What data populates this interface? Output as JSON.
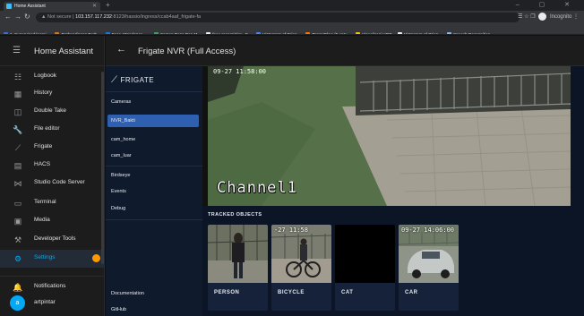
{
  "browser": {
    "tab_title": "Home Assistant",
    "new_tab_glyph": "+",
    "window_controls": "– ▢ ✕",
    "security_label": "Not secure",
    "url_host": "103.157.117.232",
    "url_path": ":8123/hassio/ingress/ccab4aaf_frigate-fa",
    "right_controls": "☰  ☆  ❐",
    "incognito_label": "Incognito",
    "bookmarks": [
      {
        "label": "1. Supervised learni...",
        "color": "#3b6edc"
      },
      {
        "label": "Perbandingan Berb...",
        "color": "#e8710a"
      },
      {
        "label": "Face Attendance -...",
        "color": "#1a73e8"
      },
      {
        "label": "Saman Desa Dan M...",
        "color": "#34a853"
      },
      {
        "label": "face-recognition - F...",
        "color": "#e8eaed"
      },
      {
        "label": "Histogram of Orien...",
        "color": "#4285f4"
      },
      {
        "label": "TensorFlow (5 untu...",
        "color": "#ff6f00"
      },
      {
        "label": "Visualisasi HOG",
        "color": "#fbbc04"
      },
      {
        "label": "Histogram of Orien...",
        "color": "#e8eaed"
      },
      {
        "label": "Speech Recognition...",
        "color": "#8ab4f8"
      }
    ]
  },
  "sidebar": {
    "menu_icon": "☰",
    "title": "Home Assistant",
    "items": [
      {
        "label": "Logbook",
        "icon": "☷"
      },
      {
        "label": "History",
        "icon": "▦"
      },
      {
        "label": "Double Take",
        "icon": "◫"
      },
      {
        "label": "File editor",
        "icon": "🔧"
      },
      {
        "label": "Frigate",
        "icon": "⟋"
      },
      {
        "label": "HACS",
        "icon": "▤"
      },
      {
        "label": "Studio Code Server",
        "icon": "⋈"
      },
      {
        "label": "Terminal",
        "icon": "▭"
      },
      {
        "label": "Media",
        "icon": "▣"
      },
      {
        "label": "Developer Tools",
        "icon": "⚒"
      },
      {
        "label": "Settings",
        "icon": "⚙"
      }
    ],
    "notifications_label": "Notifications",
    "notifications_icon": "🔔",
    "user_label": "artpintar",
    "avatar_letter": "a"
  },
  "header": {
    "back_icon": "←",
    "title": "Frigate NVR (Full Access)"
  },
  "frigate_nav": {
    "logo": "FRIGATE",
    "logo_icon": "⟋",
    "cameras": "Cameras",
    "camera_items": [
      "NVR_Bakti",
      "cam_home",
      "cam_luar"
    ],
    "active_camera": "NVR_Bakti",
    "birdseye": "Birdseye",
    "events": "Events",
    "debug": "Debug",
    "documentation": "Documentation",
    "github": "GitHub"
  },
  "camera": {
    "channel_label": "Channel1",
    "timestamp": "09-27 11:58:00"
  },
  "tracked": {
    "title": "TRACKED OBJECTS",
    "objects": [
      {
        "label": "PERSON",
        "timestamp": ""
      },
      {
        "label": "BICYCLE",
        "timestamp": "-27 11:58"
      },
      {
        "label": "CAT",
        "timestamp": ""
      },
      {
        "label": "CAR",
        "timestamp": "09-27 14:06:00"
      }
    ]
  },
  "colors": {
    "ha_accent": "#03a9f4",
    "frigate_active": "#2f5fb0",
    "badge": "#ff9800"
  }
}
